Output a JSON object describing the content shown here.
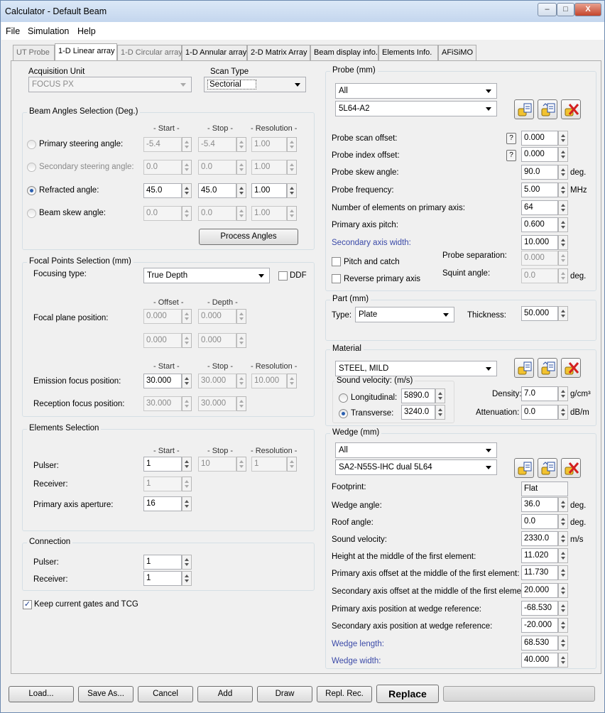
{
  "window": {
    "title": "Calculator  - Default Beam",
    "min": "–",
    "max": "□",
    "close": "X"
  },
  "menu": [
    "File",
    "Simulation",
    "Help"
  ],
  "tabs": [
    "UT Probe",
    "1-D Linear array",
    "1-D Circular array",
    "1-D Annular array",
    "2-D Matrix Array",
    "Beam display info.",
    "Elements Info.",
    "AFiSiMO"
  ],
  "acquisition": {
    "label": "Acquisition Unit",
    "value": "FOCUS PX"
  },
  "scan_type": {
    "label": "Scan Type",
    "value": "Sectorial"
  },
  "beam_angles": {
    "title": "Beam Angles Selection (Deg.)",
    "headers": [
      "- Start -",
      "- Stop -",
      "- Resolution -"
    ],
    "rows": [
      {
        "label": "Primary steering angle:",
        "start": "-5.4",
        "stop": "-5.4",
        "res": "1.00"
      },
      {
        "label": "Secondary steering angle:",
        "start": "0.0",
        "stop": "0.0",
        "res": "1.00"
      },
      {
        "label": "Refracted angle:",
        "start": "45.0",
        "stop": "45.0",
        "res": "1.00"
      },
      {
        "label": "Beam skew angle:",
        "start": "0.0",
        "stop": "0.0",
        "res": "1.00"
      }
    ],
    "process": "Process Angles"
  },
  "focal": {
    "title": "Focal Points Selection (mm)",
    "type_label": "Focusing type:",
    "type_value": "True Depth",
    "ddf": "DDF",
    "offset_hdr": "- Offset -",
    "depth_hdr": "- Depth -",
    "plane_label": "Focal plane position:",
    "plane": [
      "0.000",
      "0.000",
      "0.000",
      "0.000"
    ],
    "headers": [
      "- Start -",
      "- Stop -",
      "- Resolution -"
    ],
    "emission_label": "Emission focus position:",
    "emission": [
      "30.000",
      "30.000",
      "10.000"
    ],
    "reception_label": "Reception focus position:",
    "reception": [
      "30.000",
      "30.000"
    ]
  },
  "elements": {
    "title": "Elements Selection",
    "headers": [
      "- Start -",
      "- Stop -",
      "- Resolution -"
    ],
    "pulser_label": "Pulser:",
    "pulser": [
      "1",
      "10",
      "1"
    ],
    "receiver_label": "Receiver:",
    "receiver": "1",
    "aperture_label": "Primary axis aperture:",
    "aperture": "16"
  },
  "connection": {
    "title": "Connection",
    "pulser_label": "Pulser:",
    "pulser": "1",
    "receiver_label": "Receiver:",
    "receiver": "1"
  },
  "keep": "Keep current gates and TCG",
  "probe": {
    "title": "Probe (mm)",
    "filter": "All",
    "model": "5L64-A2",
    "rows": [
      {
        "label": "Probe scan offset:",
        "value": "0.000",
        "unit": ""
      },
      {
        "label": "Probe index offset:",
        "value": "0.000",
        "unit": ""
      },
      {
        "label": "Probe skew angle:",
        "value": "90.0",
        "unit": "deg."
      },
      {
        "label": "Probe frequency:",
        "value": "5.00",
        "unit": "MHz"
      },
      {
        "label": "Number of elements on primary axis:",
        "value": "64",
        "unit": ""
      },
      {
        "label": "Primary axis pitch:",
        "value": "0.600",
        "unit": ""
      },
      {
        "label": "Secondary axis width:",
        "value": "10.000",
        "unit": ""
      }
    ],
    "q": "?",
    "pitch_catch": "Pitch and catch",
    "reverse": "Reverse primary axis",
    "separation_label": "Probe separation:",
    "separation": "0.000",
    "squint_label": "Squint angle:",
    "squint": "0.0",
    "squint_unit": "deg."
  },
  "part": {
    "title": "Part (mm)",
    "type_label": "Type:",
    "type": "Plate",
    "thickness_label": "Thickness:",
    "thickness": "50.000"
  },
  "material": {
    "title": "Material",
    "name": "STEEL, MILD",
    "sv_label": "Sound velocity: (m/s)",
    "long_label": "Longitudinal:",
    "long": "5890.0",
    "trans_label": "Transverse:",
    "trans": "3240.0",
    "density_label": "Density:",
    "density": "7.0",
    "density_unit": "g/cm³",
    "atten_label": "Attenuation:",
    "atten": "0.0",
    "atten_unit": "dB/m"
  },
  "wedge": {
    "title": "Wedge (mm)",
    "filter": "All",
    "model": "SA2-N55S-IHC dual  5L64",
    "footprint_label": "Footprint:",
    "footprint": "Flat",
    "rows": [
      {
        "label": "Wedge angle:",
        "value": "36.0",
        "unit": "deg."
      },
      {
        "label": "Roof angle:",
        "value": "0.0",
        "unit": "deg."
      },
      {
        "label": "Sound velocity:",
        "value": "2330.0",
        "unit": "m/s"
      },
      {
        "label": "Height at the middle of the first element:",
        "value": "11.020",
        "unit": ""
      },
      {
        "label": "Primary axis offset at the middle of the first element:",
        "value": "11.730",
        "unit": ""
      },
      {
        "label": "Secondary axis offset at the middle of the first element:",
        "value": "20.000",
        "unit": ""
      },
      {
        "label": "Primary axis position at wedge reference:",
        "value": "-68.530",
        "unit": ""
      },
      {
        "label": "Secondary axis position at wedge reference:",
        "value": "-20.000",
        "unit": ""
      },
      {
        "label": "Wedge length:",
        "value": "68.530",
        "unit": ""
      },
      {
        "label": "Wedge width:",
        "value": "40.000",
        "unit": ""
      }
    ]
  },
  "buttons": {
    "load": "Load...",
    "save": "Save As...",
    "cancel": "Cancel",
    "add": "Add",
    "draw": "Draw",
    "repl_rec": "Repl. Rec.",
    "replace": "Replace"
  },
  "colors": {
    "accent_label": "#3b4aa8",
    "delete_icon": "#d42020"
  }
}
